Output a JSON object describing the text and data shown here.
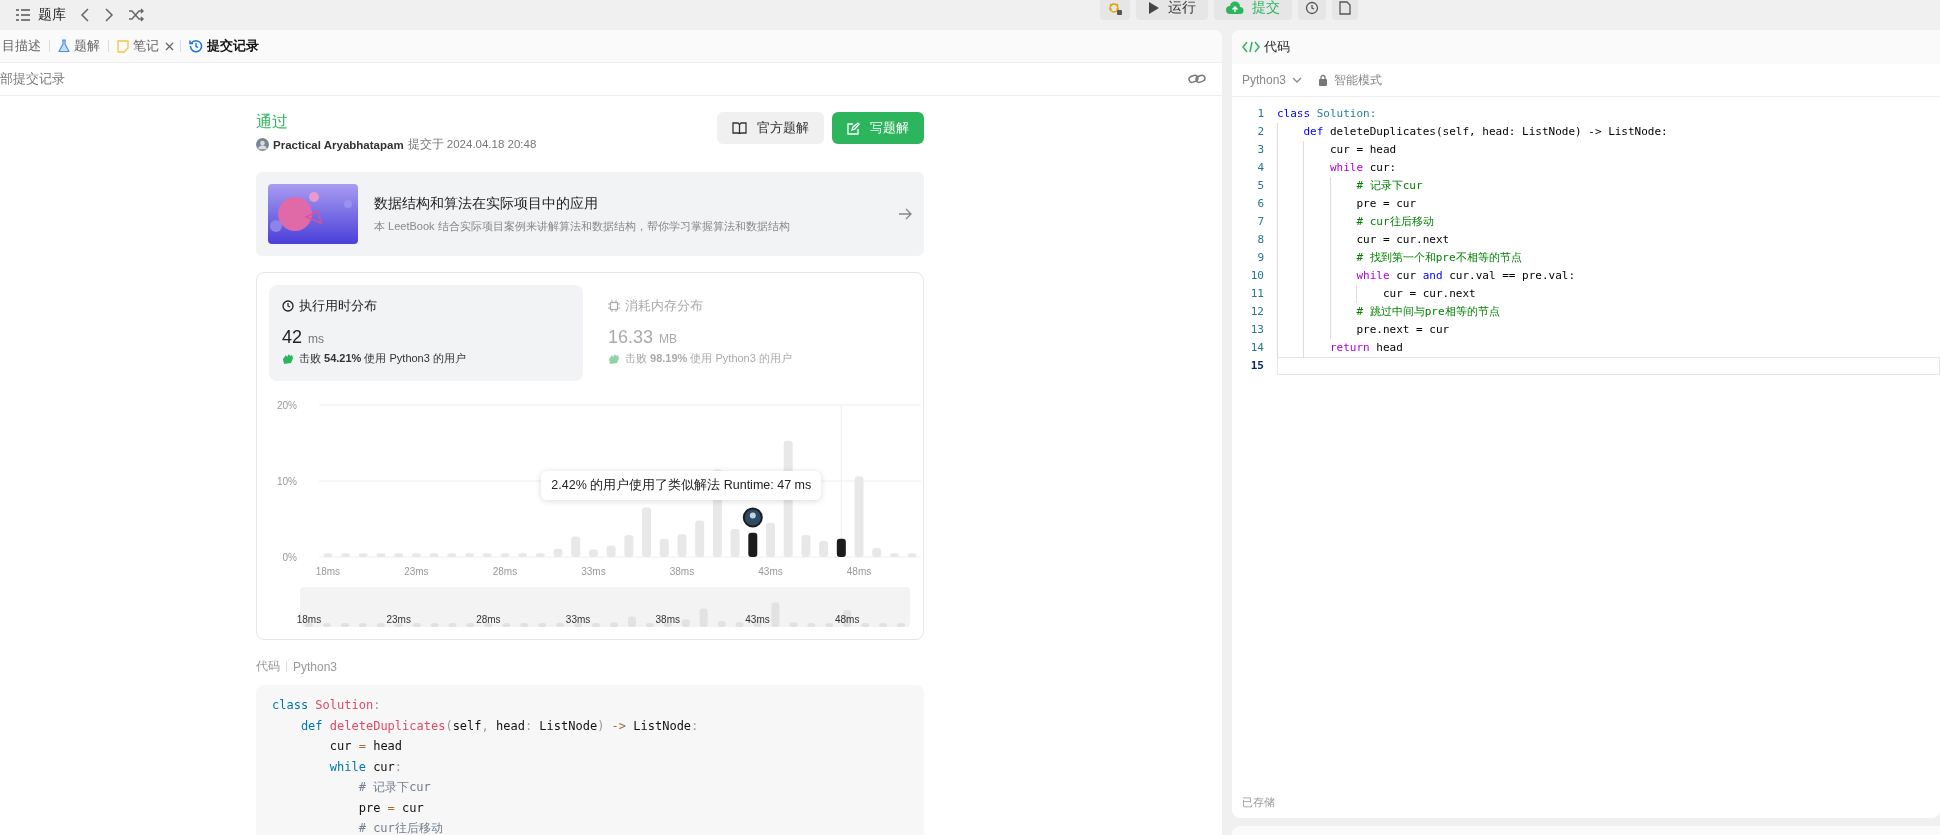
{
  "top_bar": {
    "title": "题库",
    "buttons": [
      {
        "kind": "debug"
      },
      {
        "kind": "run",
        "label": "运行"
      },
      {
        "kind": "submit",
        "label": "提交"
      },
      {
        "kind": "clock"
      },
      {
        "kind": "note"
      }
    ]
  },
  "left_tabs": [
    {
      "label": "目描述",
      "kind": "plain",
      "selected": false
    },
    {
      "label": "题解",
      "kind": "flask",
      "selected": false
    },
    {
      "label": "笔记",
      "kind": "note",
      "selected": false,
      "closable": true
    },
    {
      "label": "提交记录",
      "kind": "history",
      "selected": true
    }
  ],
  "sub_bar": {
    "title": "部提交记录"
  },
  "result": {
    "status": "通过",
    "author": "Practical Aryabhatapam",
    "submitted": "提交于 2024.04.18 20:48",
    "buttons": [
      {
        "kind": "book",
        "label": "官方题解",
        "primary": false
      },
      {
        "kind": "edit",
        "label": "写题解",
        "primary": true
      }
    ]
  },
  "book_card": {
    "title": "数据结构和算法在实际项目中的应用",
    "description": "本 LeetBook 结合实际项目案例来讲解算法和数据结构，帮你学习掌握算法和数据结构"
  },
  "stats": [
    {
      "kind": "time",
      "title": "执行用时分布",
      "value": "42",
      "unit": "ms",
      "beats": "击败 **54.21%** 使用 Python3 的用户",
      "selected": true
    },
    {
      "kind": "memory",
      "title": "消耗内存分布",
      "value": "16.33",
      "unit": "MB",
      "beats": "击败 **98.19%** 使用 Python3 的用户",
      "selected": false
    }
  ],
  "chart_data": {
    "type": "bar",
    "x": [
      18,
      19,
      20,
      21,
      22,
      23,
      24,
      25,
      26,
      27,
      28,
      29,
      30,
      31,
      32,
      33,
      34,
      35,
      36,
      37,
      38,
      39,
      40,
      41,
      42,
      43,
      44,
      45,
      46,
      47,
      48,
      49,
      50,
      51
    ],
    "series": [
      {
        "color": "#e8e8e8",
        "values": [
          0.5,
          0.5,
          0.5,
          0.5,
          0.5,
          0.5,
          0.5,
          0.5,
          0.5,
          0.5,
          0.5,
          0.5,
          0.5,
          1.1,
          2.7,
          1.0,
          1.5,
          2.9,
          6.5,
          2.4,
          3.0,
          4.8,
          11.5,
          3.7,
          null,
          4.5,
          15.3,
          2.9,
          2.1,
          null,
          10.6,
          1.2,
          0.5,
          0.5
        ]
      },
      {
        "color": "#1c1c1c",
        "values": [
          null,
          null,
          null,
          null,
          null,
          null,
          null,
          null,
          null,
          null,
          null,
          null,
          null,
          null,
          null,
          null,
          null,
          null,
          null,
          null,
          null,
          null,
          null,
          null,
          3.2,
          null,
          null,
          null,
          null,
          2.4,
          null,
          null,
          null,
          null
        ]
      }
    ],
    "xlim": [
      17.5,
      51.5
    ],
    "ylim": [
      0,
      20
    ],
    "yticks": [
      {
        "value": 0,
        "label": "0%"
      },
      {
        "value": 10,
        "label": "10%"
      },
      {
        "value": 20,
        "label": "20%"
      }
    ],
    "xticks": [
      {
        "value": 18,
        "label": "18ms"
      },
      {
        "value": 23,
        "label": "23ms"
      },
      {
        "value": 28,
        "label": "28ms"
      },
      {
        "value": 33,
        "label": "33ms"
      },
      {
        "value": 38,
        "label": "38ms"
      },
      {
        "value": 43,
        "label": "43ms"
      },
      {
        "value": 48,
        "label": "48ms"
      }
    ],
    "annotations": [
      "2.42% 的用户使用了类似解法 Runtime: 47 ms"
    ]
  },
  "overview": {
    "tick_labels": [
      "18ms",
      "23ms",
      "28ms",
      "33ms",
      "38ms",
      "43ms",
      "48ms"
    ]
  },
  "code_header": {
    "label": "代码",
    "language": "Python3"
  },
  "code_lines": [
    [
      {
        "text": "class",
        "kind": "kw"
      },
      {
        "text": " Solution",
        "kind": "cls"
      },
      {
        "text": ":",
        "kind": "punct"
      }
    ],
    [
      {
        "text": "    def",
        "kind": "kw"
      },
      {
        "text": " deleteDuplicates",
        "kind": "cls"
      },
      {
        "text": "(",
        "kind": "punct"
      },
      {
        "text": "self",
        "kind": "p"
      },
      {
        "text": ", ",
        "kind": "punct"
      },
      {
        "text": "head",
        "kind": "p"
      },
      {
        "text": ": ",
        "kind": "punct"
      },
      {
        "text": "ListNode",
        "kind": "p"
      },
      {
        "text": ") ",
        "kind": "punct"
      },
      {
        "text": "->",
        "kind": "op"
      },
      {
        "text": " ListNode",
        "kind": "p"
      },
      {
        "text": ":",
        "kind": "punct"
      }
    ],
    [
      {
        "text": "        cur ",
        "kind": "p"
      },
      {
        "text": "=",
        "kind": "op"
      },
      {
        "text": " head",
        "kind": "p"
      }
    ],
    [
      {
        "text": "        while",
        "kind": "kw"
      },
      {
        "text": " cur",
        "kind": "p"
      },
      {
        "text": ":",
        "kind": "punct"
      }
    ],
    [
      {
        "text": "            # 记录下cur",
        "kind": "com"
      }
    ],
    [
      {
        "text": "            pre ",
        "kind": "p"
      },
      {
        "text": "=",
        "kind": "op"
      },
      {
        "text": " cur",
        "kind": "p"
      }
    ],
    [
      {
        "text": "            # cur往后移动",
        "kind": "com"
      }
    ]
  ],
  "editor": {
    "title": "代码",
    "language": "Python3",
    "mode": "智能模式",
    "status": "已存储",
    "lines": [
      {
        "number": "1",
        "current": false,
        "tokens": [
          {
            "text": "class",
            "kind": "kw"
          },
          {
            "text": " Solution:",
            "kind": "cls"
          }
        ]
      },
      {
        "number": "2",
        "current": false,
        "tokens": [
          {
            "text": "    def",
            "kind": "kw"
          },
          {
            "text": " deleteDuplicates(self, head: ListNode) -> ListNode:",
            "kind": "p"
          }
        ]
      },
      {
        "number": "3",
        "current": false,
        "tokens": [
          {
            "text": "        cur = head",
            "kind": "p"
          }
        ]
      },
      {
        "number": "4",
        "current": false,
        "tokens": [
          {
            "text": "        while",
            "kind": "ctrl"
          },
          {
            "text": " cur:",
            "kind": "p"
          }
        ]
      },
      {
        "number": "5",
        "current": false,
        "tokens": [
          {
            "text": "            # 记录下cur",
            "kind": "com"
          }
        ]
      },
      {
        "number": "6",
        "current": false,
        "tokens": [
          {
            "text": "            pre = cur",
            "kind": "p"
          }
        ]
      },
      {
        "number": "7",
        "current": false,
        "tokens": [
          {
            "text": "            # cur往后移动",
            "kind": "com"
          }
        ]
      },
      {
        "number": "8",
        "current": false,
        "tokens": [
          {
            "text": "            cur = cur.next",
            "kind": "p"
          }
        ]
      },
      {
        "number": "9",
        "current": false,
        "tokens": [
          {
            "text": "            # 找到第一个和pre不相等的节点",
            "kind": "com"
          }
        ]
      },
      {
        "number": "10",
        "current": false,
        "tokens": [
          {
            "text": "            while",
            "kind": "ctrl"
          },
          {
            "text": " cur ",
            "kind": "p"
          },
          {
            "text": "and",
            "kind": "kw"
          },
          {
            "text": " cur.val == pre.val:",
            "kind": "p"
          }
        ]
      },
      {
        "number": "11",
        "current": false,
        "tokens": [
          {
            "text": "                cur = cur.next",
            "kind": "p"
          }
        ]
      },
      {
        "number": "12",
        "current": false,
        "tokens": [
          {
            "text": "            # 跳过中间与pre相等的节点",
            "kind": "com"
          }
        ]
      },
      {
        "number": "13",
        "current": false,
        "tokens": [
          {
            "text": "            pre.next = cur",
            "kind": "p"
          }
        ]
      },
      {
        "number": "14",
        "current": false,
        "tokens": [
          {
            "text": "        return",
            "kind": "ctrl"
          },
          {
            "text": " head",
            "kind": "p"
          }
        ]
      },
      {
        "number": "15",
        "current": true
      }
    ]
  }
}
